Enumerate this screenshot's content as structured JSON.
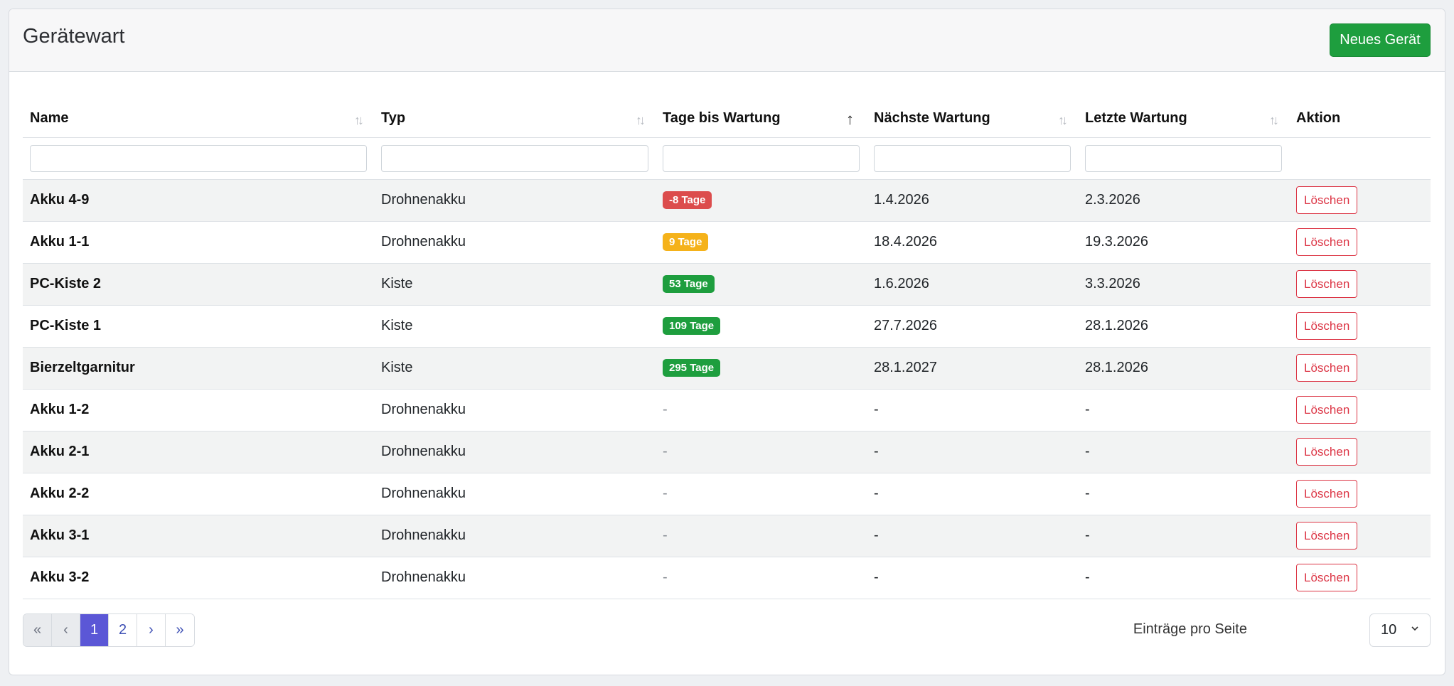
{
  "header": {
    "title": "Gerätewart",
    "new_button": "Neues Gerät"
  },
  "table": {
    "columns": [
      {
        "label": "Name",
        "sort": "none"
      },
      {
        "label": "Typ",
        "sort": "none"
      },
      {
        "label": "Tage bis Wartung",
        "sort": "ascending"
      },
      {
        "label": "Nächste Wartung",
        "sort": "none"
      },
      {
        "label": "Letzte Wartung",
        "sort": "none"
      },
      {
        "label": "Aktion",
        "sort": ""
      }
    ],
    "filter_values": [
      "",
      "",
      "",
      "",
      ""
    ],
    "rows": [
      {
        "name": "Akku 4-9",
        "typ": "Drohnenakku",
        "tage": "-8 Tage",
        "status": "red",
        "next": "1.4.2026",
        "last": "2.3.2026",
        "action": "Löschen"
      },
      {
        "name": "Akku 1-1",
        "typ": "Drohnenakku",
        "tage": "9 Tage",
        "status": "yellow",
        "next": "18.4.2026",
        "last": "19.3.2026",
        "action": "Löschen"
      },
      {
        "name": "PC-Kiste 2",
        "typ": "Kiste",
        "tage": "53 Tage",
        "status": "green",
        "next": "1.6.2026",
        "last": "3.3.2026",
        "action": "Löschen"
      },
      {
        "name": "PC-Kiste 1",
        "typ": "Kiste",
        "tage": "109 Tage",
        "status": "green",
        "next": "27.7.2026",
        "last": "28.1.2026",
        "action": "Löschen"
      },
      {
        "name": "Bierzeltgarnitur",
        "typ": "Kiste",
        "tage": "295 Tage",
        "status": "green",
        "next": "28.1.2027",
        "last": "28.1.2026",
        "action": "Löschen"
      },
      {
        "name": "Akku 1-2",
        "typ": "Drohnenakku",
        "tage": "-",
        "status": "none",
        "next": "-",
        "last": "-",
        "action": "Löschen"
      },
      {
        "name": "Akku 2-1",
        "typ": "Drohnenakku",
        "tage": "-",
        "status": "none",
        "next": "-",
        "last": "-",
        "action": "Löschen"
      },
      {
        "name": "Akku 2-2",
        "typ": "Drohnenakku",
        "tage": "-",
        "status": "none",
        "next": "-",
        "last": "-",
        "action": "Löschen"
      },
      {
        "name": "Akku 3-1",
        "typ": "Drohnenakku",
        "tage": "-",
        "status": "none",
        "next": "-",
        "last": "-",
        "action": "Löschen"
      },
      {
        "name": "Akku 3-2",
        "typ": "Drohnenakku",
        "tage": "-",
        "status": "none",
        "next": "-",
        "last": "-",
        "action": "Löschen"
      }
    ]
  },
  "pagination": {
    "first": "«",
    "prev": "‹",
    "pages": [
      "1",
      "2"
    ],
    "current": "1",
    "next": "›",
    "last": "»",
    "per_page_label": "Einträge pro Seite",
    "per_page_value": "10"
  },
  "colors": {
    "primary_green": "#1e9e3e",
    "danger_red": "#dc3545",
    "badge_red": "#dc4c4c",
    "badge_yellow": "#f5b21a",
    "page_active": "#5b57d6"
  }
}
